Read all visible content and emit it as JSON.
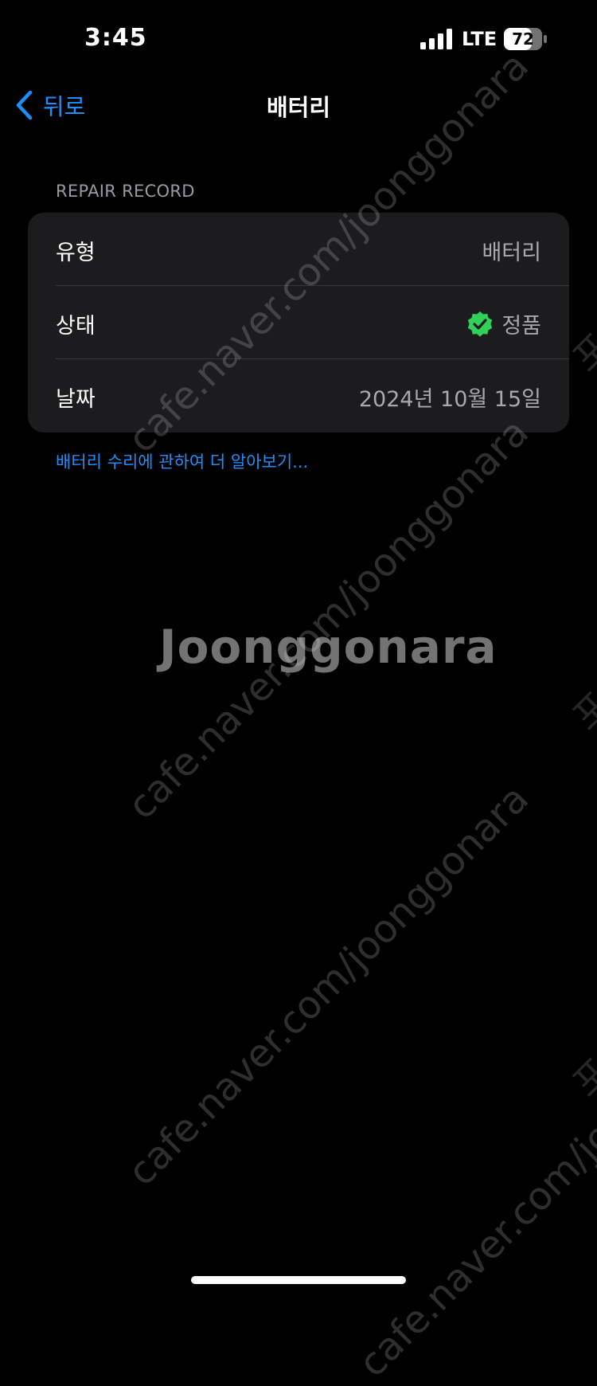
{
  "status_bar": {
    "time": "3:45",
    "network": "LTE",
    "battery": "72"
  },
  "nav": {
    "back_label": "뒤로",
    "title": "배터리"
  },
  "section": {
    "header": "REPAIR RECORD"
  },
  "rows": [
    {
      "label": "유형",
      "value": "배터리"
    },
    {
      "label": "상태",
      "value": "정품"
    },
    {
      "label": "날짜",
      "value": "2024년 10월 15일"
    }
  ],
  "link": {
    "learn_more": "배터리 수리에 관하여 더 알아보기..."
  },
  "watermark": {
    "url": "cafe.naver.com/joonggonara",
    "side": "포드",
    "brand": "Joonggonara"
  },
  "colors": {
    "accent": "#1e8ff6",
    "check_badge": "#30d158",
    "card_bg": "#1c1c1e"
  }
}
